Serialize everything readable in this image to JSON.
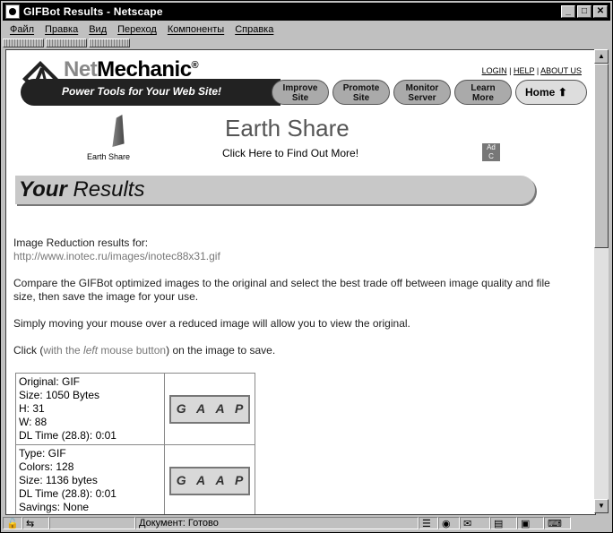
{
  "window": {
    "title": "GIFBot Results - Netscape"
  },
  "menu": [
    "Файл",
    "Правка",
    "Вид",
    "Переход",
    "Компоненты",
    "Справка"
  ],
  "header": {
    "brand_a": "Net",
    "brand_b": "Mechanic",
    "brand_mark": "®",
    "tagline": "Power Tools for Your Web Site!",
    "links": [
      "LOGIN",
      "HELP",
      "ABOUT US"
    ],
    "nav": [
      {
        "label_1": "Improve",
        "label_2": "Site"
      },
      {
        "label_1": "Promote",
        "label_2": "Site"
      },
      {
        "label_1": "Monitor",
        "label_2": "Server"
      },
      {
        "label_1": "Learn",
        "label_2": "More"
      }
    ],
    "home": "Home"
  },
  "ad": {
    "title": "Earth Share",
    "cta": "Click Here to Find Out More!",
    "logo_caption": "Earth Share",
    "council": "Ad Council"
  },
  "results": {
    "heading_bold": "Your",
    "heading_rest": " Results",
    "intro": "Image Reduction results for:",
    "url": "http://www.inotec.ru/images/inotec88x31.gif",
    "compare": "Compare the GIFBot optimized images to the original and select the best trade off between image quality and file size, then save the image for your use.",
    "mouseover": "Simply moving your mouse over a reduced image will allow you to view the original.",
    "click_a": "Click (",
    "click_b": "with the ",
    "click_c": "left",
    "click_d": " mouse button",
    "click_e": ") on the image to save.",
    "rows": [
      {
        "lines": [
          "Original: GIF",
          "Size: 1050 Bytes",
          "H: 31",
          "W: 88",
          "DL Time (28.8): 0:01"
        ]
      },
      {
        "lines": [
          "Type: GIF",
          "Colors: 128",
          "Size: 1136 bytes",
          "DL Time (28.8): 0:01",
          "Savings: None"
        ]
      }
    ],
    "thumb_letters": [
      "G",
      "A",
      "A",
      "P"
    ]
  },
  "status": {
    "text": "Документ: Готово"
  }
}
